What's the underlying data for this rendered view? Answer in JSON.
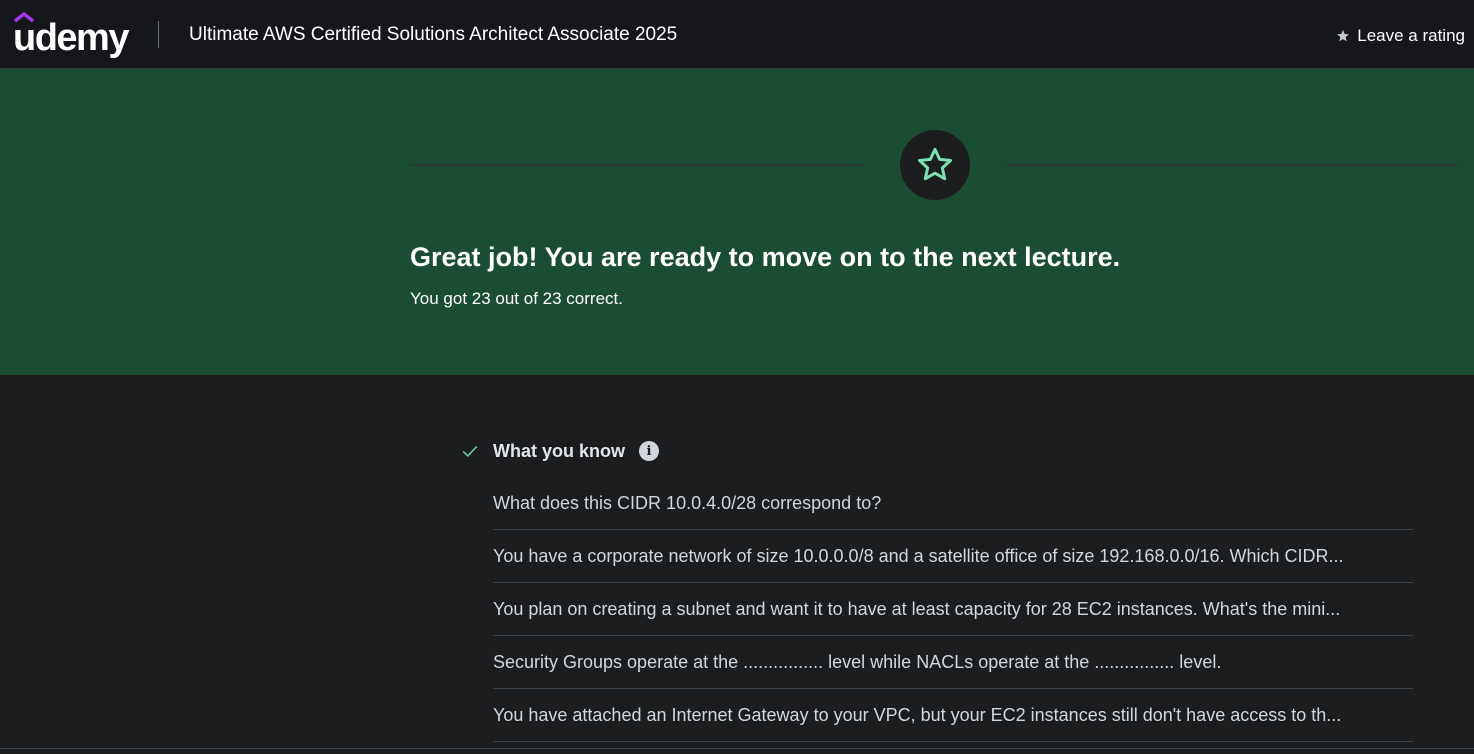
{
  "header": {
    "logo_text": "udemy",
    "course_title": "Ultimate AWS Certified Solutions Architect Associate 2025",
    "rating_label": "Leave a rating",
    "rating_icon": "star-icon"
  },
  "hero": {
    "icon": "star-outline-icon",
    "title": "Great job! You are ready to move on to the next lecture.",
    "subtitle": "You got 23 out of 23 correct.",
    "score": {
      "correct": 23,
      "total": 23
    }
  },
  "what_you_know": {
    "title": "What you know",
    "check_icon": "checkmark-icon",
    "info_icon": "info-icon",
    "questions": [
      "What does this CIDR 10.0.4.0/28 correspond to?",
      "You have a corporate network of size 10.0.0.0/8 and a satellite office of size 192.168.0.0/16. Which CIDR...",
      "You plan on creating a subnet and want it to have at least capacity for 28 EC2 instances. What's the mini...",
      "Security Groups operate at the ................ level while NACLs operate at the ................ level.",
      "You have attached an Internet Gateway to your VPC, but your EC2 instances still don't have access to th..."
    ]
  },
  "colors": {
    "header_bg": "#16161d",
    "hero_bg": "#1b4d35",
    "page_bg": "#1c1d1f",
    "accent_purple": "#a435f0",
    "star_accent": "#7ee0b0",
    "check_green": "#6ad3a4"
  }
}
